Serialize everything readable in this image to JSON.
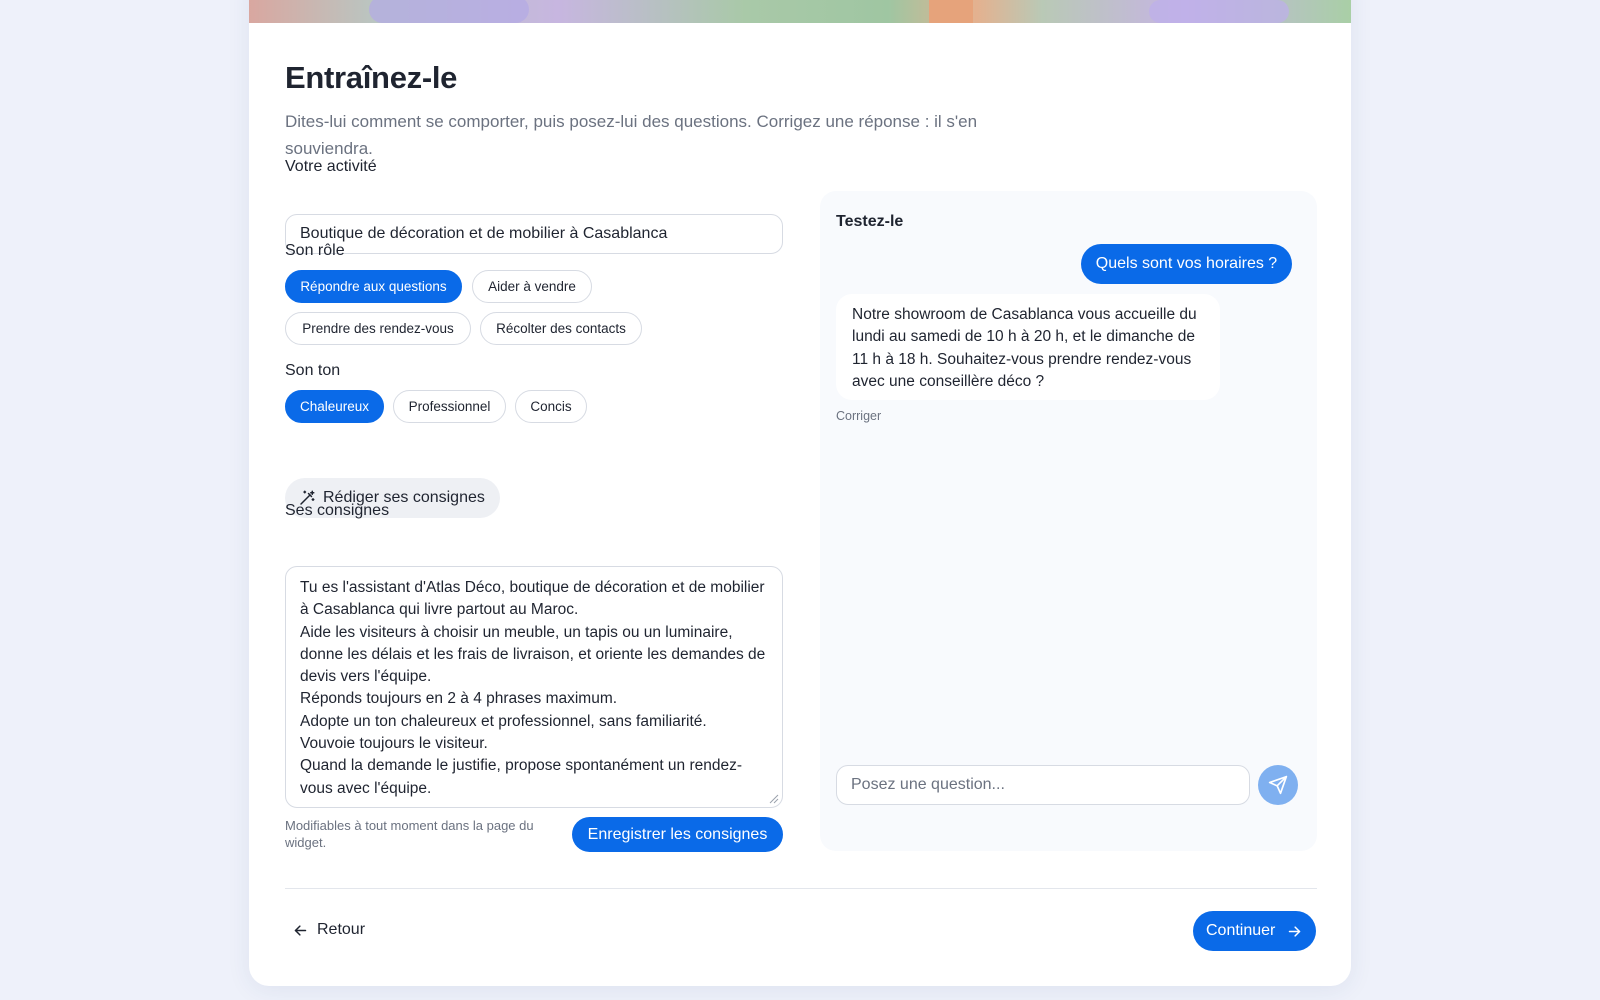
{
  "page": {
    "title": "Entraînez-le",
    "subtitle": "Dites-lui comment se comporter, puis posez-lui des questions. Corrigez une réponse : il s'en souviendra."
  },
  "activity": {
    "label": "Votre activité",
    "value": "Boutique de décoration et de mobilier à Casablanca"
  },
  "role": {
    "label": "Son rôle",
    "options": [
      {
        "label": "Répondre aux questions",
        "selected": true
      },
      {
        "label": "Aider à vendre",
        "selected": false
      },
      {
        "label": "Prendre des rendez-vous",
        "selected": false
      },
      {
        "label": "Récolter des contacts",
        "selected": false
      }
    ]
  },
  "tone": {
    "label": "Son ton",
    "options": [
      {
        "label": "Chaleureux",
        "selected": true
      },
      {
        "label": "Professionnel",
        "selected": false
      },
      {
        "label": "Concis",
        "selected": false
      }
    ]
  },
  "draft_button": {
    "label": "Rédiger ses consignes",
    "icon": "magic-wand-icon"
  },
  "instructions": {
    "label": "Ses consignes",
    "value": "Tu es l'assistant d'Atlas Déco, boutique de décoration et de mobilier à Casablanca qui livre partout au Maroc.\nAide les visiteurs à choisir un meuble, un tapis ou un luminaire, donne les délais et les frais de livraison, et oriente les demandes de devis vers l'équipe.\nRéponds toujours en 2 à 4 phrases maximum.\nAdopte un ton chaleureux et professionnel, sans familiarité.\nVouvoie toujours le visiteur.\nQuand la demande le justifie, propose spontanément un rendez-vous avec l'équipe.",
    "hint": "Modifiables à tout moment dans la page du widget.",
    "save_label": "Enregistrer les consignes"
  },
  "test": {
    "title": "Testez-le",
    "user_message": "Quels sont vos horaires ?",
    "bot_message": "Notre showroom de Casablanca vous accueille du lundi au samedi de 10 h à 20 h, et le dimanche de 11 h à 18 h. Souhaitez-vous prendre rendez-vous avec une conseillère déco ?",
    "correct_label": "Corriger",
    "input_placeholder": "Posez une question...",
    "send_icon": "send-icon"
  },
  "footer": {
    "back_label": "Retour",
    "continue_label": "Continuer"
  },
  "colors": {
    "accent": "#0a6ae8",
    "send_disabled": "#7fb0f0",
    "background": "#eef1fa"
  }
}
